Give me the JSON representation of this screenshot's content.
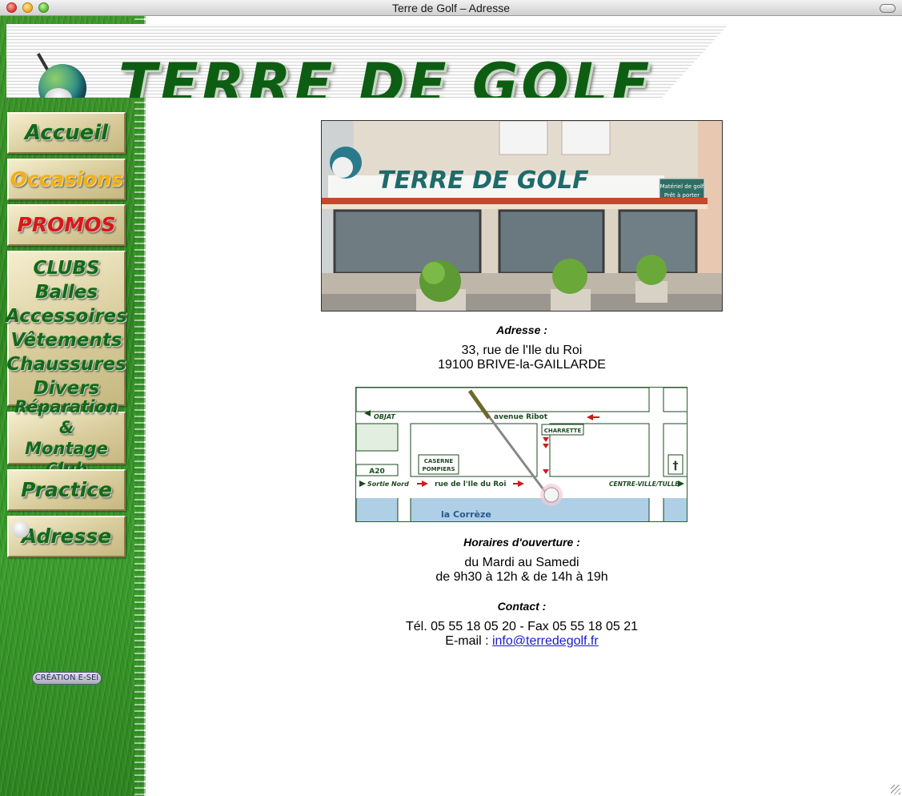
{
  "window": {
    "title": "Terre de Golf – Adresse"
  },
  "brand": {
    "name": "TERRE DE GOLF"
  },
  "nav": {
    "accueil": "Accueil",
    "occasions": "Occasions",
    "promos": "PROMOS",
    "products": [
      "CLUBS",
      "Balles",
      "Accessoires",
      "Vêtements",
      "Chaussures",
      "Divers"
    ],
    "reparation": [
      "Réparation &",
      "Montage Club"
    ],
    "practice": "Practice",
    "adresse": "Adresse"
  },
  "credit": {
    "label": "CRÉATION E-SEI"
  },
  "storefront": {
    "sign": "TERRE DE GOLF",
    "sign_small": [
      "Matériel de golf",
      "Prêt à porter"
    ]
  },
  "address": {
    "heading": "Adresse :",
    "street": "33, rue de l'Ile du Roi",
    "city": "19100 BRIVE-la-GAILLARDE"
  },
  "map": {
    "labels": {
      "objat": "OBJAT",
      "avenue": "avenue Ribot",
      "charrette": "CHARRETTE",
      "caserne": "CASERNE",
      "pompiers": "POMPIERS",
      "a20": "A20",
      "sortie": "Sortie Nord",
      "rue": "rue de l'Ile du Roi",
      "centre": "CENTRE-VILLE/TULLE",
      "riviere": "la Corrèze",
      "cross": "†"
    },
    "colors": {
      "water": "#aecfe6",
      "block": "#e2efe0",
      "road_text": "#1d4a22",
      "arrow": "#cc1b1b"
    }
  },
  "hours": {
    "heading": "Horaires d'ouverture :",
    "days": "du Mardi au Samedi",
    "times": "de 9h30 à 12h & de 14h à 19h"
  },
  "contact": {
    "heading": "Contact :",
    "phone": "Tél. 05 55 18 05 20 - Fax 05 55 18 05 21",
    "email_prefix": "E-mail : ",
    "email": "info@terredegolf.fr"
  }
}
